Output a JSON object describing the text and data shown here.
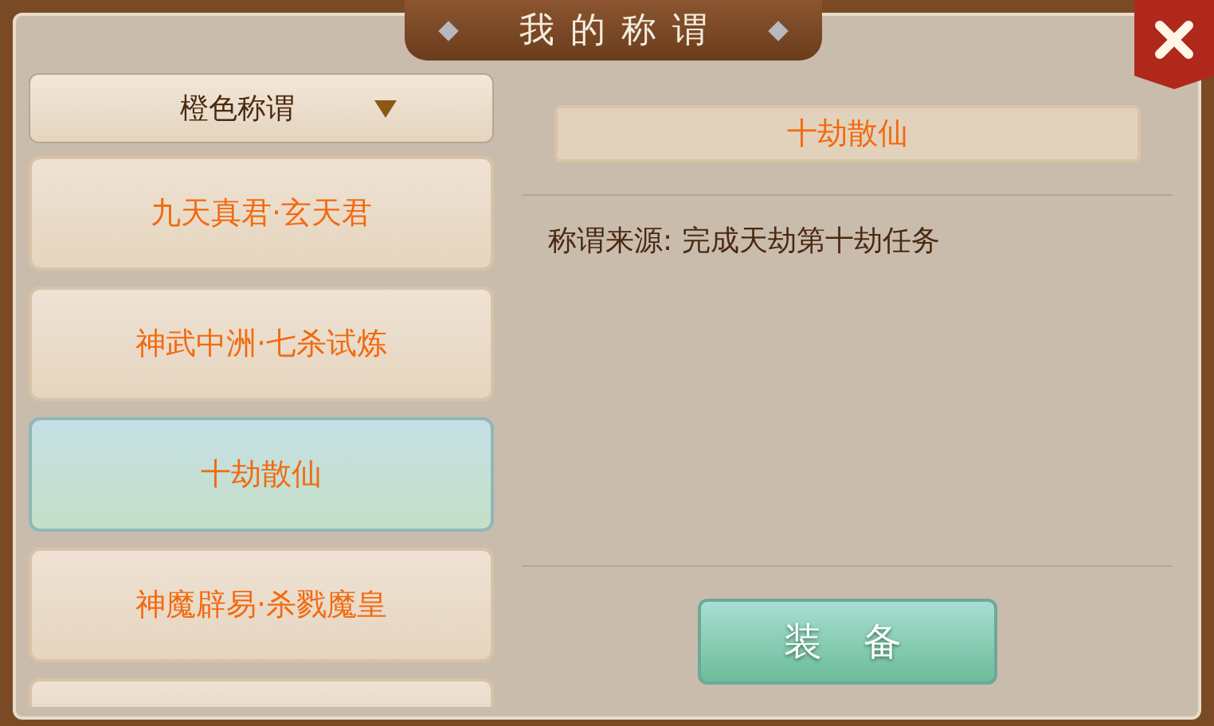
{
  "window": {
    "title": "我的称谓"
  },
  "filter": {
    "value": "橙色称谓"
  },
  "titles": [
    {
      "label": "九天真君·玄天君",
      "selected": false
    },
    {
      "label": "神武中洲·七杀试炼",
      "selected": false
    },
    {
      "label": "十劫散仙",
      "selected": true
    },
    {
      "label": "神魔辟易·杀戮魔皇",
      "selected": false
    }
  ],
  "detail": {
    "name": "十劫散仙",
    "source": "称谓来源: 完成天劫第十劫任务"
  },
  "buttons": [
    "装备"
  ]
}
